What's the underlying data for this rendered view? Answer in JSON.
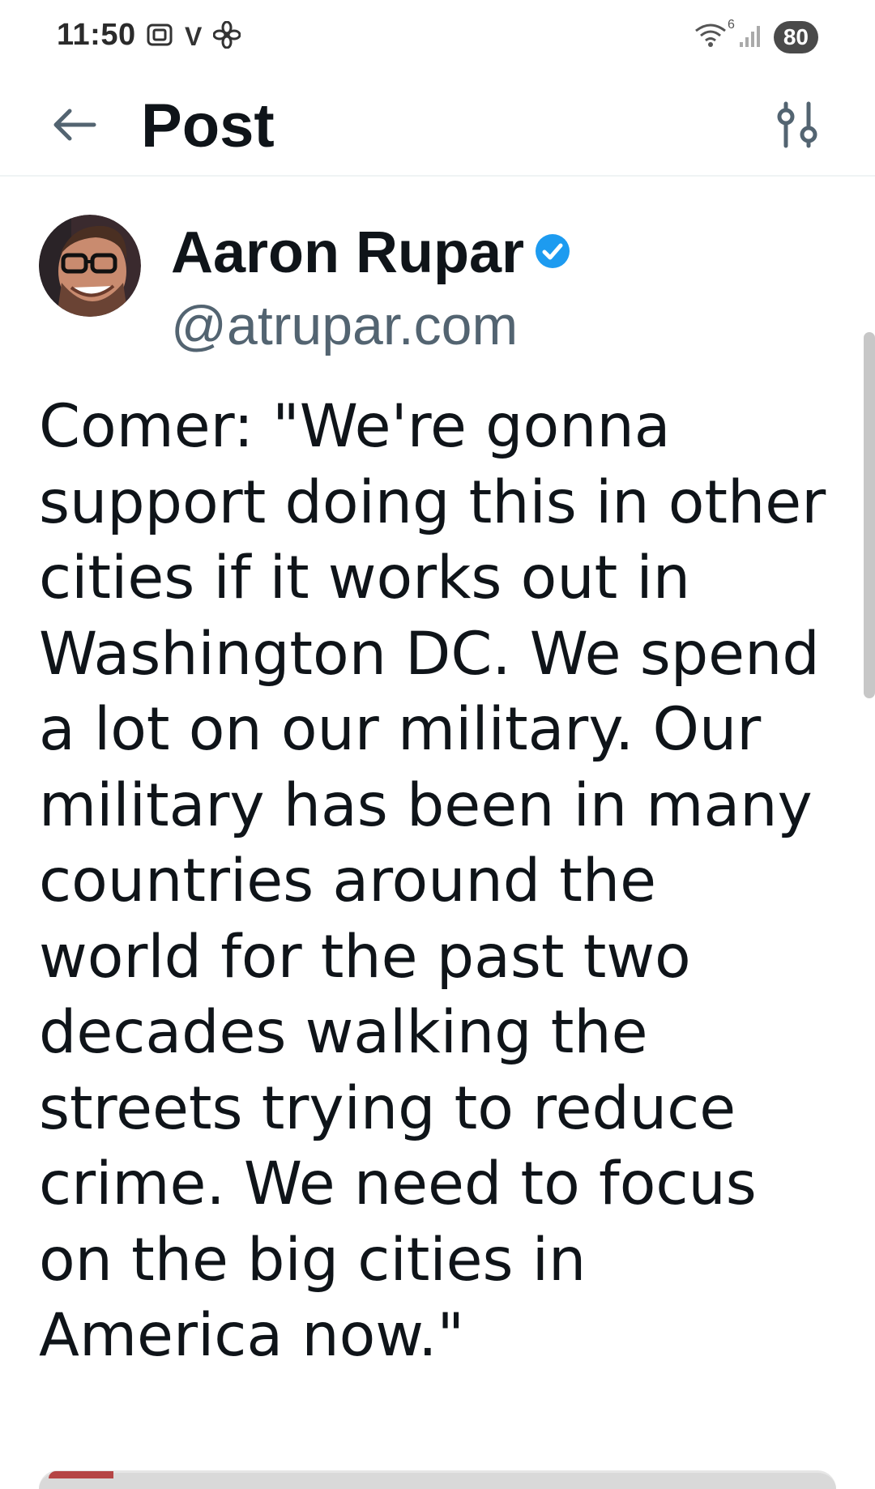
{
  "status_bar": {
    "time": "11:50",
    "left_icons": [
      "screenshot-icon",
      "v-icon",
      "fan-icon"
    ],
    "v_glyph": "V",
    "wifi_badge": "6",
    "battery_level": "80"
  },
  "header": {
    "title": "Post"
  },
  "post": {
    "author_name": "Aaron Rupar",
    "author_handle": "@atrupar.com",
    "verified": true,
    "text": "Comer: \"We're gonna support doing this in other cities if it works out in Washington DC. We spend a lot on our military. Our military has been in many countries around the world for the past two decades walking the streets trying to reduce crime. We need to focus on the big cities in America now.\""
  },
  "colors": {
    "accent": "#1d9bf0",
    "text_primary": "#0f1419",
    "text_secondary": "#536471",
    "icon_muted": "#536471"
  }
}
